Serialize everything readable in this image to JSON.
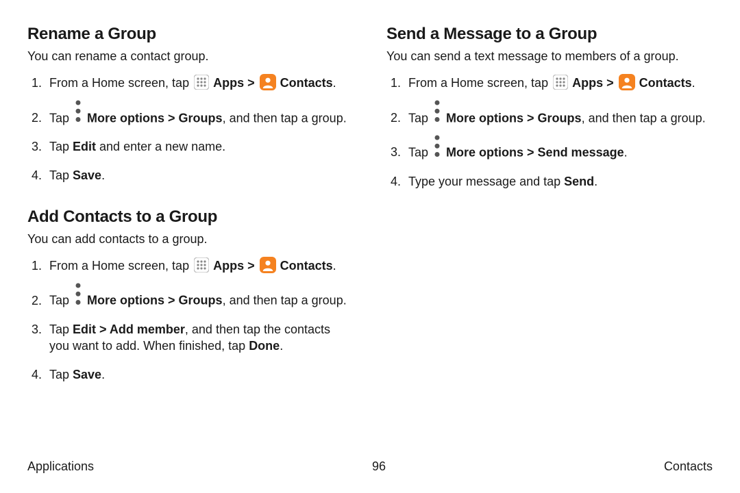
{
  "left": {
    "section1": {
      "heading": "Rename a Group",
      "desc": "You can rename a contact group.",
      "steps": {
        "s1_pre": "From a Home screen, tap ",
        "apps": "Apps",
        "chev": " > ",
        "contacts": "Contacts",
        "period": ".",
        "s2_pre": "Tap ",
        "s2_more": "More options > Groups",
        "s2_post": ", and then tap a group.",
        "s3_pre": "Tap ",
        "s3_edit": "Edit",
        "s3_post": " and enter a new name.",
        "s4_pre": "Tap ",
        "s4_save": "Save",
        "s4_post": "."
      }
    },
    "section2": {
      "heading": "Add Contacts to a Group",
      "desc": "You can add contacts to a group.",
      "steps": {
        "s1_pre": "From a Home screen, tap ",
        "apps": "Apps",
        "chev": " > ",
        "contacts": "Contacts",
        "period": ".",
        "s2_pre": "Tap ",
        "s2_more": "More options > Groups",
        "s2_post": ", and then tap a group.",
        "s3_pre": "Tap ",
        "s3_bold": "Edit > Add member",
        "s3_mid": ", and then tap the contacts you want to add. When finished, tap ",
        "s3_done": "Done",
        "s3_post": ".",
        "s4_pre": "Tap ",
        "s4_save": "Save",
        "s4_post": "."
      }
    }
  },
  "right": {
    "section1": {
      "heading": "Send a Message to a Group",
      "desc": "You can send a text message to members of a group.",
      "steps": {
        "s1_pre": "From a Home screen, tap ",
        "apps": "Apps",
        "chev": " > ",
        "contacts": "Contacts",
        "period": ".",
        "s2_pre": "Tap ",
        "s2_more": "More options > Groups",
        "s2_post": ", and then tap a group.",
        "s3_pre": "Tap ",
        "s3_more": "More options > Send message",
        "s3_post": ".",
        "s4_pre": "Type your message and tap ",
        "s4_send": "Send",
        "s4_post": "."
      }
    }
  },
  "footer": {
    "left": "Applications",
    "center": "96",
    "right": "Contacts"
  }
}
